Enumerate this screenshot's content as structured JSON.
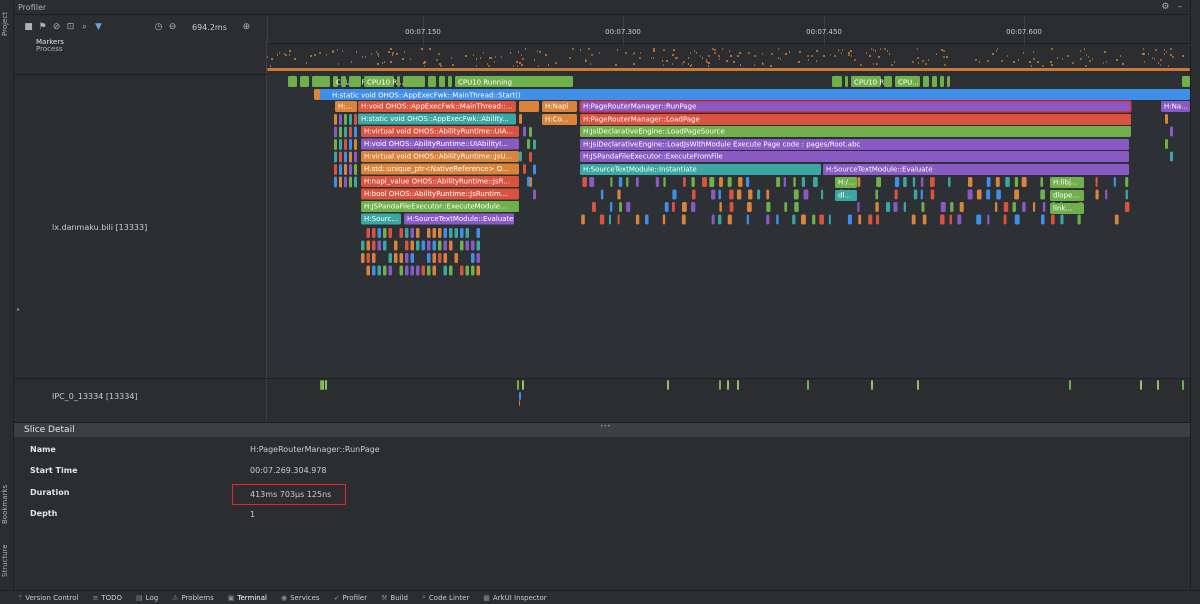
{
  "window": {
    "title": "Profiler"
  },
  "side_left": {
    "project": "Project",
    "bookmarks": "Bookmarks",
    "structure": "Structure"
  },
  "toolbar": {
    "zoom_level": "694.2ms"
  },
  "ruler": {
    "ticks": [
      {
        "label": "00:07.150",
        "pos": 0.168
      },
      {
        "label": "00:07.300",
        "pos": 0.385
      },
      {
        "label": "00:07.450",
        "pos": 0.602
      },
      {
        "label": "00:07.600",
        "pos": 0.819
      }
    ]
  },
  "lanes": {
    "markers": "Markers",
    "process": "Process",
    "thread": "lx.danmaku.bili [13333]",
    "ipc": "IPC_0_13334 [13334]"
  },
  "cpu_labels": [
    "CPU10 Ru...",
    "CPU10 R...",
    "CPU10 Running",
    "CPU10 R...",
    "CPU..."
  ],
  "slices": {
    "root": "H:static void OHOS::AppExecFwk::MainThread::Start()",
    "left_stack": [
      "H:void OHOS::AppExecFwk::MainThread::...",
      "H:static void OHOS::AppExecFwk::Ability...",
      "H:virtual void OHOS::AbilityRuntime::UIA...",
      "H:void OHOS::AbilityRuntime::UIAbilityI...",
      "H:virtual void OHOS::AbilityRuntime::JsU...",
      "H:std::unique_ptr<NativeReference> O...",
      "H:napi_value OHOS::AbilityRuntime::JsR...",
      "H:bool OHOS::AbilityRuntime::JsRuntim...",
      "H:JSPandaFileExecutor::ExecuteModule...",
      "H:Sourc...",
      "H:SourceTextModule::Evaluate"
    ],
    "small": [
      "H:...",
      "H:Napi",
      "H:Co...",
      "H:Na...",
      "H:/...",
      "dl...",
      "H:libj...",
      "dlope...",
      "link..."
    ],
    "right_stack": [
      "H:PageRouterManager::RunPage",
      "H:PageRouterManager::LoadPage",
      "H:JsiDeclarativeEngine::LoadPageSource",
      "H:JsiDeclarativeEngine::LoadJsWithModule Execute Page code : pages/Root.abc",
      "H:JSPandaFileExecutor::ExecuteFromFile",
      "H:SourceTextModule::Instantiate",
      "H:SourceTextModule::Evaluate"
    ]
  },
  "detail": {
    "title": "Slice Detail",
    "rows": [
      {
        "key": "Name",
        "value": "H:PageRouterManager::RunPage"
      },
      {
        "key": "Start Time",
        "value": "00:07.269.304.978"
      },
      {
        "key": "Duration",
        "value": "413ms 703μs 125ns"
      },
      {
        "key": "Depth",
        "value": "1"
      }
    ]
  },
  "bottom_tabs": [
    {
      "label": "Version Control",
      "icon": "branch-icon"
    },
    {
      "label": "TODO",
      "icon": "list-icon"
    },
    {
      "label": "Log",
      "icon": "log-icon"
    },
    {
      "label": "Problems",
      "icon": "warning-icon"
    },
    {
      "label": "Terminal",
      "icon": "terminal-icon"
    },
    {
      "label": "Services",
      "icon": "services-icon"
    },
    {
      "label": "Profiler",
      "icon": "profiler-icon"
    },
    {
      "label": "Build",
      "icon": "hammer-icon"
    },
    {
      "label": "Code Linter",
      "icon": "search-icon"
    },
    {
      "label": "ArkUI Inspector",
      "icon": "inspector-icon"
    }
  ],
  "colors": {
    "orange": "#d9843a",
    "purple": "#8a5ac4",
    "green": "#6fb04a",
    "teal": "#3aa7a3",
    "red": "#d9533e",
    "blue": "#3f8fe8",
    "highlight": "#e5262b"
  }
}
